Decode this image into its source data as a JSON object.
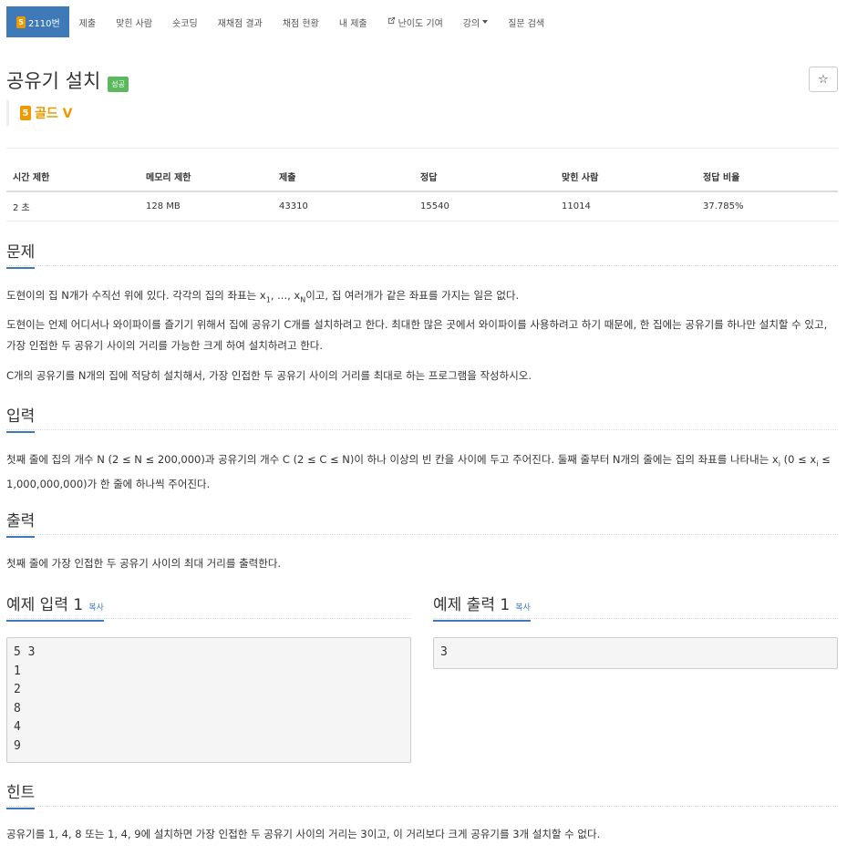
{
  "nav": {
    "tabs": [
      {
        "label": "2110번",
        "tier": "5",
        "active": true
      },
      {
        "label": "제출"
      },
      {
        "label": "맞힌 사람"
      },
      {
        "label": "숏코딩"
      },
      {
        "label": "재채점 결과"
      },
      {
        "label": "채점 현황"
      },
      {
        "label": "내 제출"
      },
      {
        "label": "난이도 기여",
        "icon": "external-link-icon"
      },
      {
        "label": "강의",
        "icon": "caret-down-icon"
      },
      {
        "label": "질문 검색"
      }
    ]
  },
  "problem": {
    "title": "공유기 설치",
    "result_badge": "성공",
    "star": "☆",
    "tier_num": "5",
    "tier_label": "골드 V"
  },
  "info_table": {
    "headers": [
      "시간 제한",
      "메모리 제한",
      "제출",
      "정답",
      "맞힌 사람",
      "정답 비율"
    ],
    "values": [
      "2 초",
      "128 MB",
      "43310",
      "15540",
      "11014",
      "37.785%"
    ]
  },
  "sections": {
    "description_title": "문제",
    "description_p1_a": "도현이의 집 N개가 수직선 위에 있다. 각각의 집의 좌표는 x",
    "description_p1_sub1": "1",
    "description_p1_b": ", ..., x",
    "description_p1_subN": "N",
    "description_p1_c": "이고, 집 여러개가 같은 좌표를 가지는 일은 없다.",
    "description_p2": "도현이는 언제 어디서나 와이파이를 즐기기 위해서 집에 공유기 C개를 설치하려고 한다. 최대한 많은 곳에서 와이파이를 사용하려고 하기 때문에, 한 집에는 공유기를 하나만 설치할 수 있고, 가장 인접한 두 공유기 사이의 거리를 가능한 크게 하여 설치하려고 한다.",
    "description_p3": "C개의 공유기를 N개의 집에 적당히 설치해서, 가장 인접한 두 공유기 사이의 거리를 최대로 하는 프로그램을 작성하시오.",
    "input_title": "입력",
    "input_p_a": "첫째 줄에 집의 개수 N (2 ≤ N ≤ 200,000)과 공유기의 개수 C (2 ≤ C ≤ N)이 하나 이상의 빈 칸을 사이에 두고 주어진다. 둘째 줄부터 N개의 줄에는 집의 좌표를 나타내는 x",
    "input_p_sub1": "i",
    "input_p_b": " (0 ≤ x",
    "input_p_sub2": "i",
    "input_p_c": " ≤ 1,000,000,000)가 한 줄에 하나씩 주어진다.",
    "output_title": "출력",
    "output_p": "첫째 줄에 가장 인접한 두 공유기 사이의 최대 거리를 출력한다.",
    "sample_input_title": "예제 입력 1",
    "sample_output_title": "예제 출력 1",
    "copy_label": "복사",
    "sample_input": "5 3\n1\n2\n8\n4\n9",
    "sample_output": "3",
    "hint_title": "힌트",
    "hint_p": "공유기를 1, 4, 8 또는 1, 4, 9에 설치하면 가장 인접한 두 공유기 사이의 거리는 3이고, 이 거리보다 크게 공유기를 3개 설치할 수 없다."
  },
  "colors": {
    "accent": "#3e7ab8",
    "gold": "#ec9a00",
    "success": "#5cb85c"
  }
}
